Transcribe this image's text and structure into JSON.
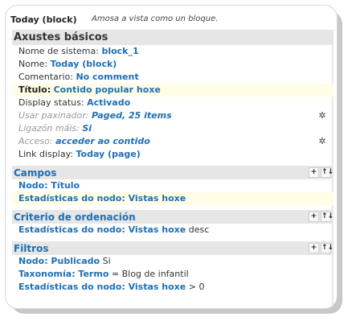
{
  "display": {
    "name": "Today (block)",
    "description": "Amosa a vista como un bloque."
  },
  "basic": {
    "title": "Axustes básicos",
    "rows": [
      {
        "label": "Nome de sistema:",
        "value": "block_1"
      },
      {
        "label": "Nome:",
        "value": "Today (block)"
      },
      {
        "label": "Comentario:",
        "value": "No comment"
      },
      {
        "label": "Título:",
        "value": "Contido popular hoxe"
      },
      {
        "label": "Display status:",
        "value": "Activado"
      },
      {
        "label": "Usar paxinador:",
        "value": "Paged, 25 items"
      },
      {
        "label": "Ligazón máis:",
        "value": "Si"
      },
      {
        "label": "Acceso:",
        "value": "acceder ao contido"
      },
      {
        "label": "Link display:",
        "value": "Today (page)"
      }
    ]
  },
  "fields": {
    "title": "Campos",
    "rows": [
      {
        "value": "Nodo: Título"
      },
      {
        "value": "Estadísticas do nodo: Vistas hoxe"
      }
    ]
  },
  "sort": {
    "title": "Criterio de ordenación",
    "rows": [
      {
        "value": "Estadísticas do nodo: Vistas hoxe",
        "rest": " desc"
      }
    ]
  },
  "filters": {
    "title": "Filtros",
    "rows": [
      {
        "value": "Nodo: Publicado",
        "rest": " Si"
      },
      {
        "value": "Taxonomía: Termo",
        "rest": " = Blog de infantil"
      },
      {
        "value": "Estadísticas do nodo: Vistas hoxe",
        "rest": " > 0"
      }
    ]
  },
  "controls": {
    "add": "+",
    "rearrange": "↑↓",
    "settings": "✲"
  },
  "colors": {
    "link": "#1f6fb2",
    "section_bg": "#e6e6e6",
    "highlight": "#fffde6"
  }
}
